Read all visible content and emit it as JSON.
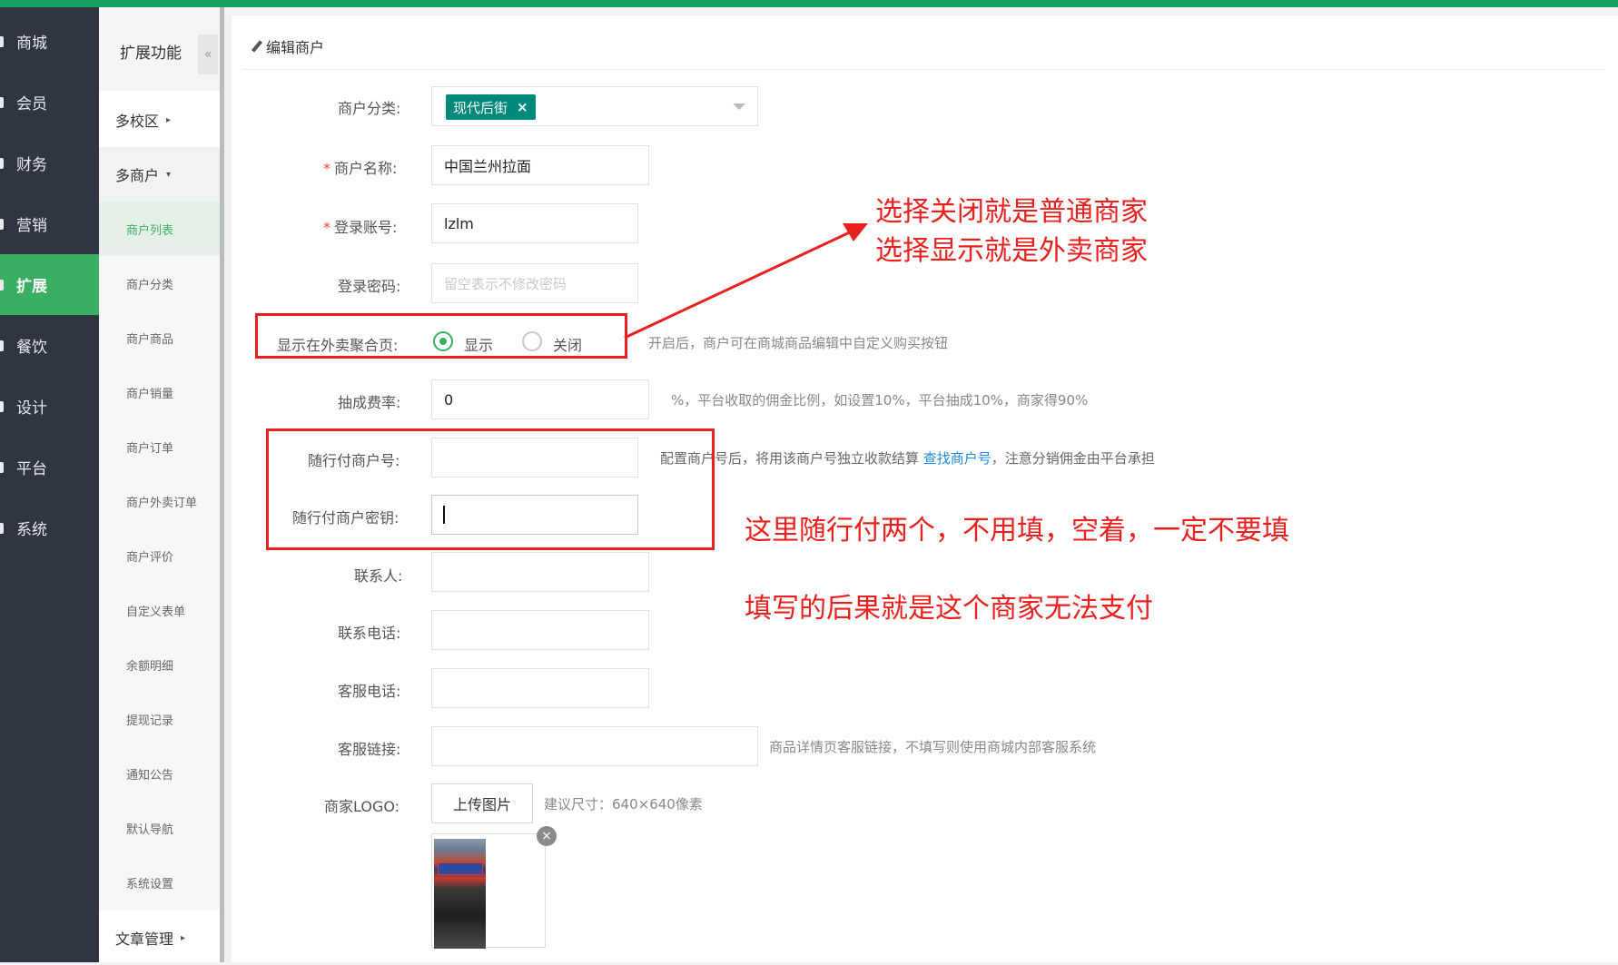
{
  "colors": {
    "accent": "#3cae64",
    "nav_bg": "#2f3541",
    "tag": "#00897b",
    "annotation": "#e8211f",
    "link": "#1e88e5"
  },
  "nav": {
    "items": [
      {
        "label": "商城",
        "icon": "shop-icon"
      },
      {
        "label": "会员",
        "icon": "member-icon"
      },
      {
        "label": "财务",
        "icon": "finance-icon"
      },
      {
        "label": "营销",
        "icon": "marketing-icon"
      },
      {
        "label": "扩展",
        "icon": "extend-icon",
        "active": true
      },
      {
        "label": "餐饮",
        "icon": "food-icon"
      },
      {
        "label": "设计",
        "icon": "design-icon"
      },
      {
        "label": "平台",
        "icon": "platform-icon"
      },
      {
        "label": "系统",
        "icon": "system-icon"
      }
    ]
  },
  "submenu": {
    "title": "扩展功能",
    "collapse": "«",
    "groups": [
      {
        "label": "多校区",
        "caret": "▸"
      },
      {
        "label": "多商户",
        "caret": "▾"
      },
      {
        "label": "文章管理",
        "caret": "▸"
      }
    ],
    "items": [
      "商户列表",
      "商户分类",
      "商户商品",
      "商户销量",
      "商户订单",
      "商户外卖订单",
      "商户评价",
      "自定义表单",
      "余额明细",
      "提现记录",
      "通知公告",
      "默认导航",
      "系统设置"
    ]
  },
  "page": {
    "title": "编辑商户"
  },
  "form": {
    "category": {
      "label": "商户分类:",
      "tag": "现代后街",
      "tag_remove": "×"
    },
    "name": {
      "label": "商户名称:",
      "value": "中国兰州拉面",
      "required": "*"
    },
    "account": {
      "label": "登录账号:",
      "value": "lzlm",
      "required": "*"
    },
    "password": {
      "label": "登录密码:",
      "placeholder": "留空表示不修改密码"
    },
    "show_in_takeout": {
      "label": "显示在外卖聚合页:",
      "option_show": "显示",
      "option_close": "关闭",
      "help": "开启后，商户可在商城商品编辑中自定义购买按钮"
    },
    "commission": {
      "label": "抽成费率:",
      "value": "0",
      "help": "%，平台收取的佣金比例，如设置10%，平台抽成10%，商家得90%"
    },
    "pay_merchant_no": {
      "label": "随行付商户号:",
      "value": "",
      "help_before": "配置商户号后，将用该商户号独立收款结算 ",
      "help_link": "查找商户号",
      "help_after": "，注意分销佣金由平台承担"
    },
    "pay_merchant_key": {
      "label": "随行付商户密钥:",
      "value": ""
    },
    "contact": {
      "label": "联系人:",
      "value": ""
    },
    "phone": {
      "label": "联系电话:",
      "value": ""
    },
    "service_phone": {
      "label": "客服电话:",
      "value": ""
    },
    "service_link": {
      "label": "客服链接:",
      "value": "",
      "help": "商品详情页客服链接，不填写则使用商城内部客服系统"
    },
    "logo": {
      "label": "商家LOGO:",
      "button": "上传图片",
      "help": "建议尺寸：640×640像素",
      "delete": "×"
    }
  },
  "annotations": {
    "top_line1": "选择关闭就是普通商家",
    "top_line2": "选择显示就是外卖商家",
    "middle": "这里随行付两个，不用填，空着，一定不要填",
    "bottom": "填写的后果就是这个商家无法支付"
  }
}
